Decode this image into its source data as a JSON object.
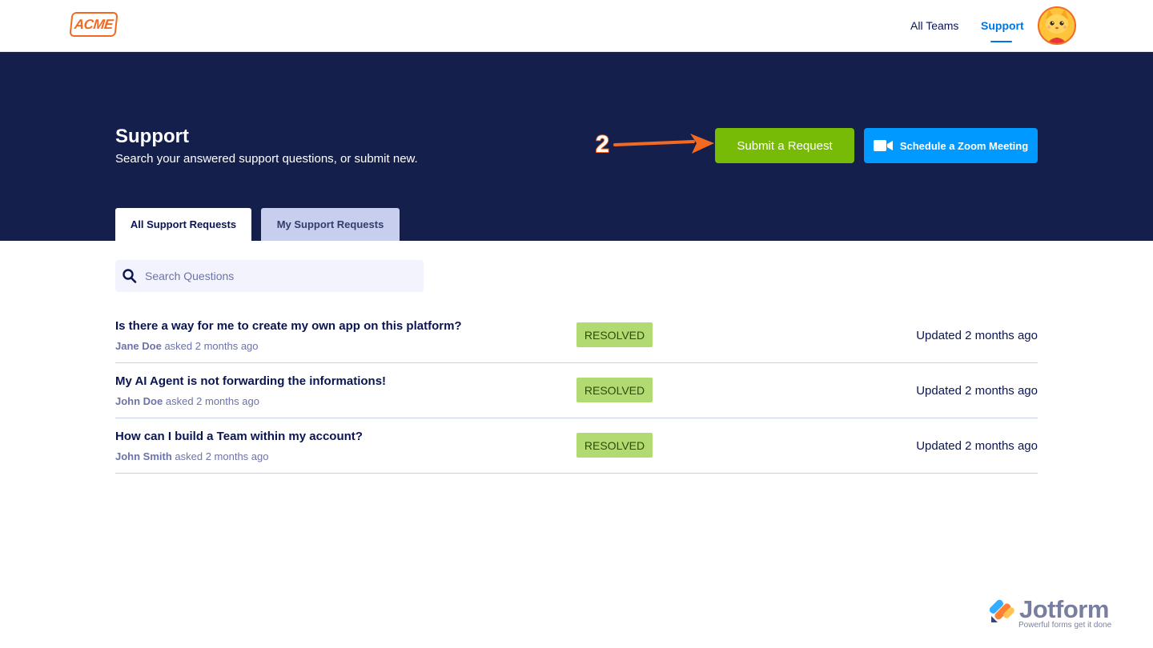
{
  "header": {
    "logo_text": "ACME",
    "nav": [
      {
        "label": "All Teams",
        "active": false
      },
      {
        "label": "Support",
        "active": true
      }
    ]
  },
  "hero": {
    "title": "Support",
    "subtitle": "Search your answered support questions, or submit new.",
    "submit_label": "Submit a Request",
    "zoom_label": "Schedule a Zoom Meeting",
    "step_number": "2"
  },
  "tabs": [
    {
      "label": "All Support Requests",
      "active": true
    },
    {
      "label": "My Support Requests",
      "active": false
    }
  ],
  "search": {
    "placeholder": "Search Questions",
    "value": ""
  },
  "questions": [
    {
      "title": "Is there a way for me to create my own app on this platform?",
      "author": "Jane Doe",
      "asked": "asked 2 months ago",
      "status": "RESOLVED",
      "updated": "Updated 2 months ago"
    },
    {
      "title": "My AI Agent is not forwarding the informations!",
      "author": "John Doe",
      "asked": "asked 2 months ago",
      "status": "RESOLVED",
      "updated": "Updated 2 months ago"
    },
    {
      "title": "How can I build a Team within my account?",
      "author": "John Smith",
      "asked": "asked 2 months ago",
      "status": "RESOLVED",
      "updated": "Updated 2 months ago"
    }
  ],
  "watermark": {
    "brand": "Jotform",
    "tagline": "Powerful forms get it done"
  },
  "colors": {
    "hero_bg": "#141f4b",
    "submit_green": "#78bb07",
    "zoom_blue": "#0099ff",
    "accent_orange": "#f26a21",
    "link_blue": "#0075e3",
    "resolved_badge": "#b1db72"
  }
}
